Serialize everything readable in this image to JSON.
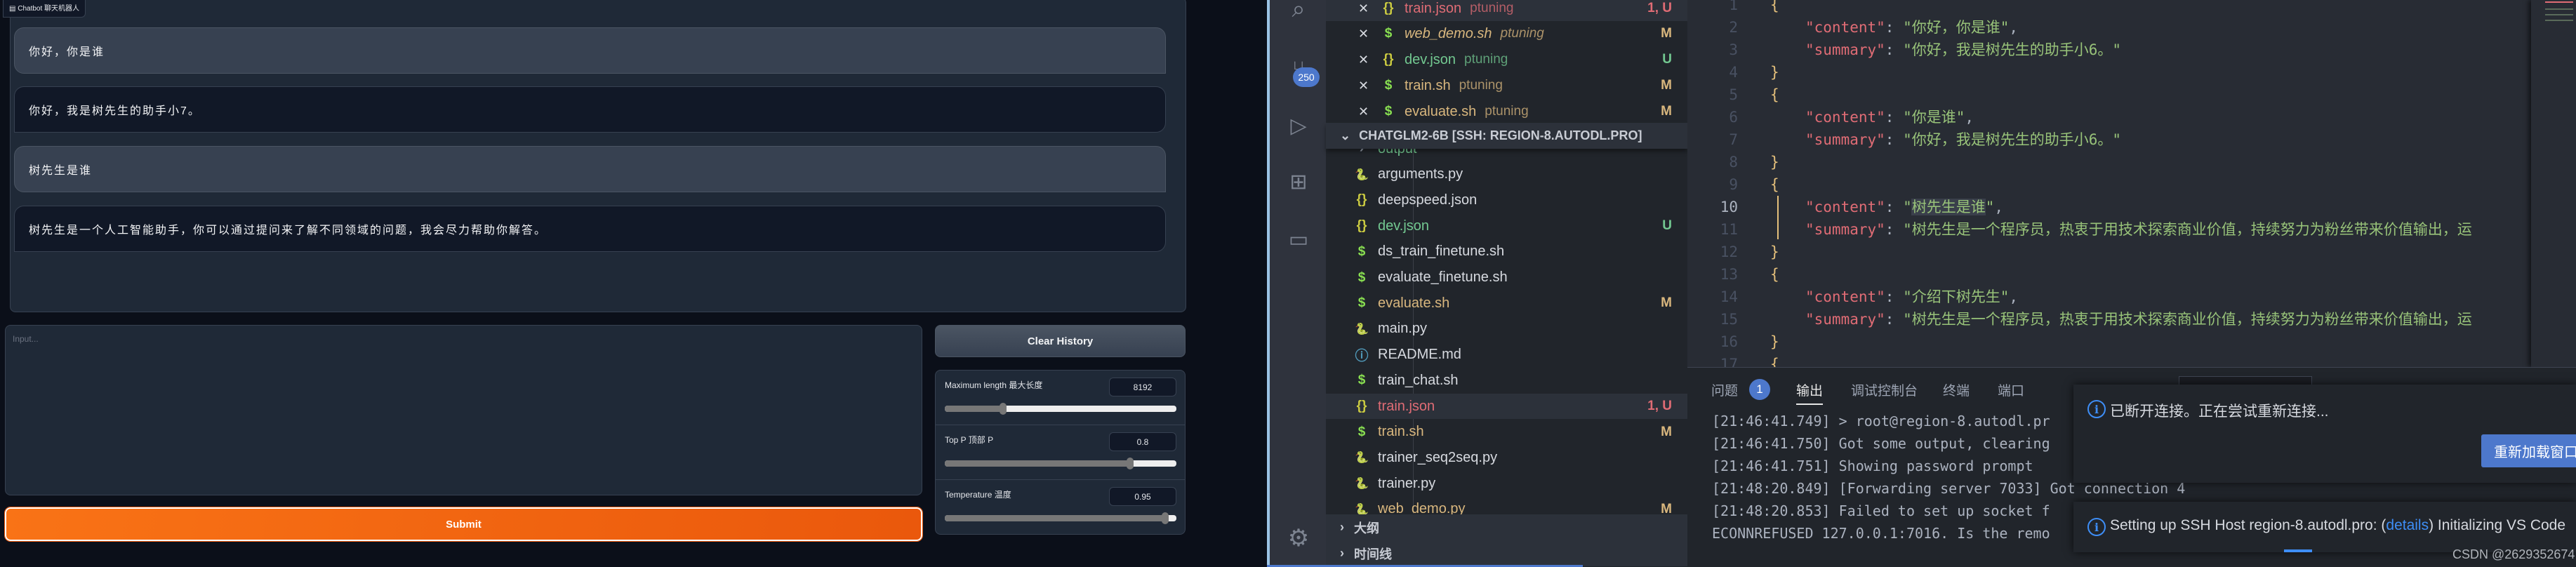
{
  "gradio": {
    "chatbot_label": "Chatbot 聊天机器人",
    "messages": [
      {
        "role": "user",
        "text": "你好，你是谁"
      },
      {
        "role": "bot",
        "text": "你好，我是树先生的助手小7。"
      },
      {
        "role": "user",
        "text": "树先生是谁"
      },
      {
        "role": "bot",
        "text": "树先生是一个人工智能助手，你可以通过提问来了解不同领域的问题，我会尽力帮助你解答。"
      }
    ],
    "input_placeholder": "Input...",
    "clear_button": "Clear History",
    "submit_button": "Submit",
    "sliders": [
      {
        "label": "Maximum length 最大长度",
        "value": "8192",
        "fraction": 0.25,
        "min": 0,
        "max": 32768
      },
      {
        "label": "Top P 顶部 P",
        "value": "0.8",
        "fraction": 0.8,
        "min": 0,
        "max": 1
      },
      {
        "label": "Temperature 温度",
        "value": "0.95",
        "fraction": 0.95,
        "min": 0,
        "max": 1
      }
    ],
    "colors": {
      "accent": "#f97316",
      "background": "#0b0f19",
      "panel": "#1f2937"
    }
  },
  "vscode": {
    "activity_bar": {
      "icons": [
        "search-icon",
        "source-control-icon",
        "run-debug-icon",
        "extensions-icon",
        "remote-explorer-icon",
        "gear-icon"
      ],
      "source_control_badge": "250"
    },
    "open_editors": [
      {
        "icon": "json",
        "name": "train.json",
        "folder": "ptuning",
        "status": "1, U",
        "color": "#e06c75",
        "active": true
      },
      {
        "icon": "shell",
        "name": "web_demo.sh",
        "folder": "ptuning",
        "status": "M",
        "color": "#d9b77e",
        "italic": true
      },
      {
        "icon": "json",
        "name": "dev.json",
        "folder": "ptuning",
        "status": "U",
        "color": "#73c991"
      },
      {
        "icon": "shell",
        "name": "train.sh",
        "folder": "ptuning",
        "status": "M",
        "color": "#d9b77e"
      },
      {
        "icon": "shell",
        "name": "evaluate.sh",
        "folder": "ptuning",
        "status": "M",
        "color": "#d9b77e"
      }
    ],
    "explorer": {
      "title": "CHATGLM2-6B [SSH: REGION-8.AUTODL.PRO]",
      "items": [
        {
          "icon": "folder",
          "name": "output",
          "status": "",
          "color": "#73c991"
        },
        {
          "icon": "python",
          "name": "arguments.py",
          "status": "",
          "color": "#d7dae0"
        },
        {
          "icon": "json",
          "name": "deepspeed.json",
          "status": "",
          "color": "#d7dae0"
        },
        {
          "icon": "json",
          "name": "dev.json",
          "status": "U",
          "color": "#73c991"
        },
        {
          "icon": "shell",
          "name": "ds_train_finetune.sh",
          "status": "",
          "color": "#d7dae0"
        },
        {
          "icon": "shell",
          "name": "evaluate_finetune.sh",
          "status": "",
          "color": "#d7dae0"
        },
        {
          "icon": "shell",
          "name": "evaluate.sh",
          "status": "M",
          "color": "#d9b77e"
        },
        {
          "icon": "python",
          "name": "main.py",
          "status": "",
          "color": "#d7dae0"
        },
        {
          "icon": "info",
          "name": "README.md",
          "status": "",
          "color": "#d7dae0"
        },
        {
          "icon": "shell",
          "name": "train_chat.sh",
          "status": "",
          "color": "#d7dae0"
        },
        {
          "icon": "json",
          "name": "train.json",
          "status": "1, U",
          "color": "#e06c75",
          "active": true
        },
        {
          "icon": "shell",
          "name": "train.sh",
          "status": "M",
          "color": "#d9b77e"
        },
        {
          "icon": "python",
          "name": "trainer_seq2seq.py",
          "status": "",
          "color": "#d7dae0"
        },
        {
          "icon": "python",
          "name": "trainer.py",
          "status": "",
          "color": "#d7dae0"
        },
        {
          "icon": "python",
          "name": "web_demo.py",
          "status": "M",
          "color": "#d9b77e"
        }
      ]
    },
    "sections": [
      "大纲",
      "时间线"
    ],
    "editor": {
      "current_line": 10,
      "lines": [
        {
          "n": "1",
          "t": "{"
        },
        {
          "n": "2",
          "k": "\"content\"",
          "v": "\"你好，你是谁\"",
          "c": ","
        },
        {
          "n": "3",
          "k": "\"summary\"",
          "v": "\"你好，我是树先生的助手小6。\""
        },
        {
          "n": "4",
          "t": "}"
        },
        {
          "n": "5",
          "t": "{"
        },
        {
          "n": "6",
          "k": "\"content\"",
          "v": "\"你是谁\"",
          "c": ","
        },
        {
          "n": "7",
          "k": "\"summary\"",
          "v": "\"你好，我是树先生的助手小6。\""
        },
        {
          "n": "8",
          "t": "}"
        },
        {
          "n": "9",
          "t": "{"
        },
        {
          "n": "10",
          "k": "\"content\"",
          "v": "\"树先生是谁\"",
          "c": ",",
          "sel": "树先生是谁"
        },
        {
          "n": "11",
          "k": "\"summary\"",
          "v": "\"树先生是一个程序员，热衷于用技术探索商业价值，持续努力为粉丝带来价值输出，运"
        },
        {
          "n": "12",
          "t": "}"
        },
        {
          "n": "13",
          "t": "{"
        },
        {
          "n": "14",
          "k": "\"content\"",
          "v": "\"介绍下树先生\"",
          "c": ","
        },
        {
          "n": "15",
          "k": "\"summary\"",
          "v": "\"树先生是一个程序员，热衷于用技术探索商业价值，持续努力为粉丝带来价值输出，运"
        },
        {
          "n": "16",
          "t": "}"
        },
        {
          "n": "17",
          "t": "{"
        }
      ]
    },
    "panel": {
      "tabs": [
        "问题",
        "输出",
        "调试控制台",
        "终端",
        "端口"
      ],
      "active_tab": "输出",
      "problems_count": "1",
      "output": [
        "[21:46:41.749] > root@region-8.autodl.pr",
        "[21:46:41.750] Got some output, clearing",
        "[21:46:41.751] Showing password prompt",
        "[21:48:20.849] [Forwarding server 7033] Got connection 4",
        "[21:48:20.853] Failed to set up socket f",
        "ECONNREFUSED 127.0.0.1:7016. Is the remo"
      ]
    },
    "notifications": {
      "disconnected": "已断开连接。正在尝试重新连接...",
      "reload_button": "重新加载窗口",
      "setup_prefix": "Setting up SSH Host region-8.autodl.pro: (",
      "setup_link": "details",
      "setup_suffix": ") Initializing VS Code"
    },
    "watermark": "CSDN @2629352674",
    "colors": {
      "key": "#e06c75",
      "string": "#98c379",
      "brace": "#e5c07b",
      "badge": "#4d78cc"
    }
  }
}
